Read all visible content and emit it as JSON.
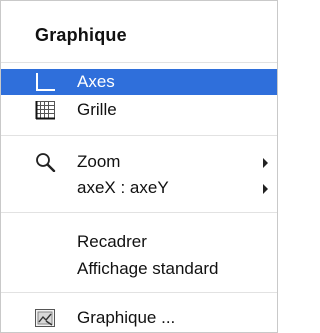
{
  "menu": {
    "title": "Graphique",
    "items": [
      {
        "label": "Axes",
        "icon": "axes-icon",
        "selected": true
      },
      {
        "label": "Grille",
        "icon": "grid-icon",
        "selected": false
      },
      {
        "label": "Zoom",
        "icon": "magnifier-icon",
        "submenu": true
      },
      {
        "label": "axeX : axeY",
        "submenu": true
      },
      {
        "label": "Recadrer"
      },
      {
        "label": "Affichage standard"
      },
      {
        "label": "Graphique ...",
        "icon": "graph-settings-icon"
      }
    ],
    "colors": {
      "selection": "#2f6fdb",
      "text": "#111111",
      "separator": "#e2e2e2"
    }
  }
}
